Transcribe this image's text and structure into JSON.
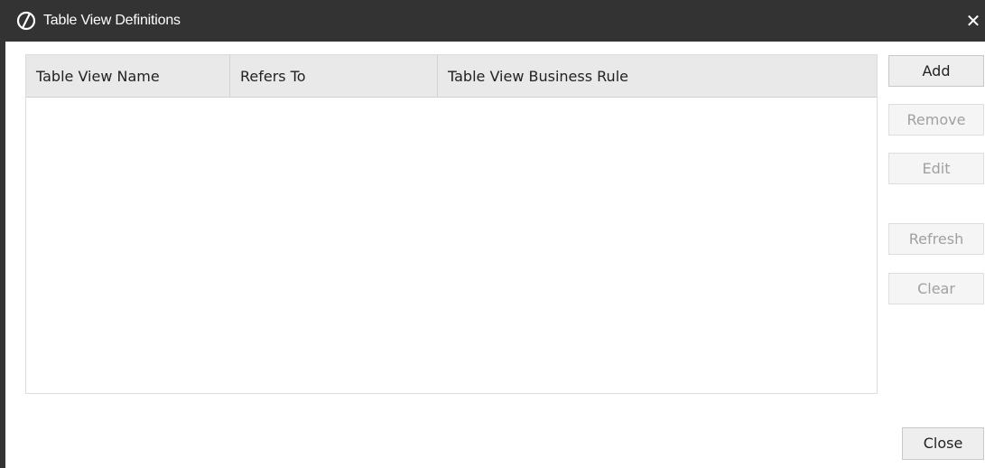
{
  "window": {
    "title": "Table View Definitions",
    "close_symbol": "✕",
    "app_icon": "oracle-o-icon"
  },
  "table": {
    "columns": [
      "Table View Name",
      "Refers To",
      "Table View Business Rule"
    ],
    "rows": []
  },
  "buttons": {
    "add": "Add",
    "remove": "Remove",
    "edit": "Edit",
    "refresh": "Refresh",
    "clear": "Clear",
    "close": "Close"
  },
  "colors": {
    "titlebar": "#333333",
    "header": "#e9e9e9"
  }
}
